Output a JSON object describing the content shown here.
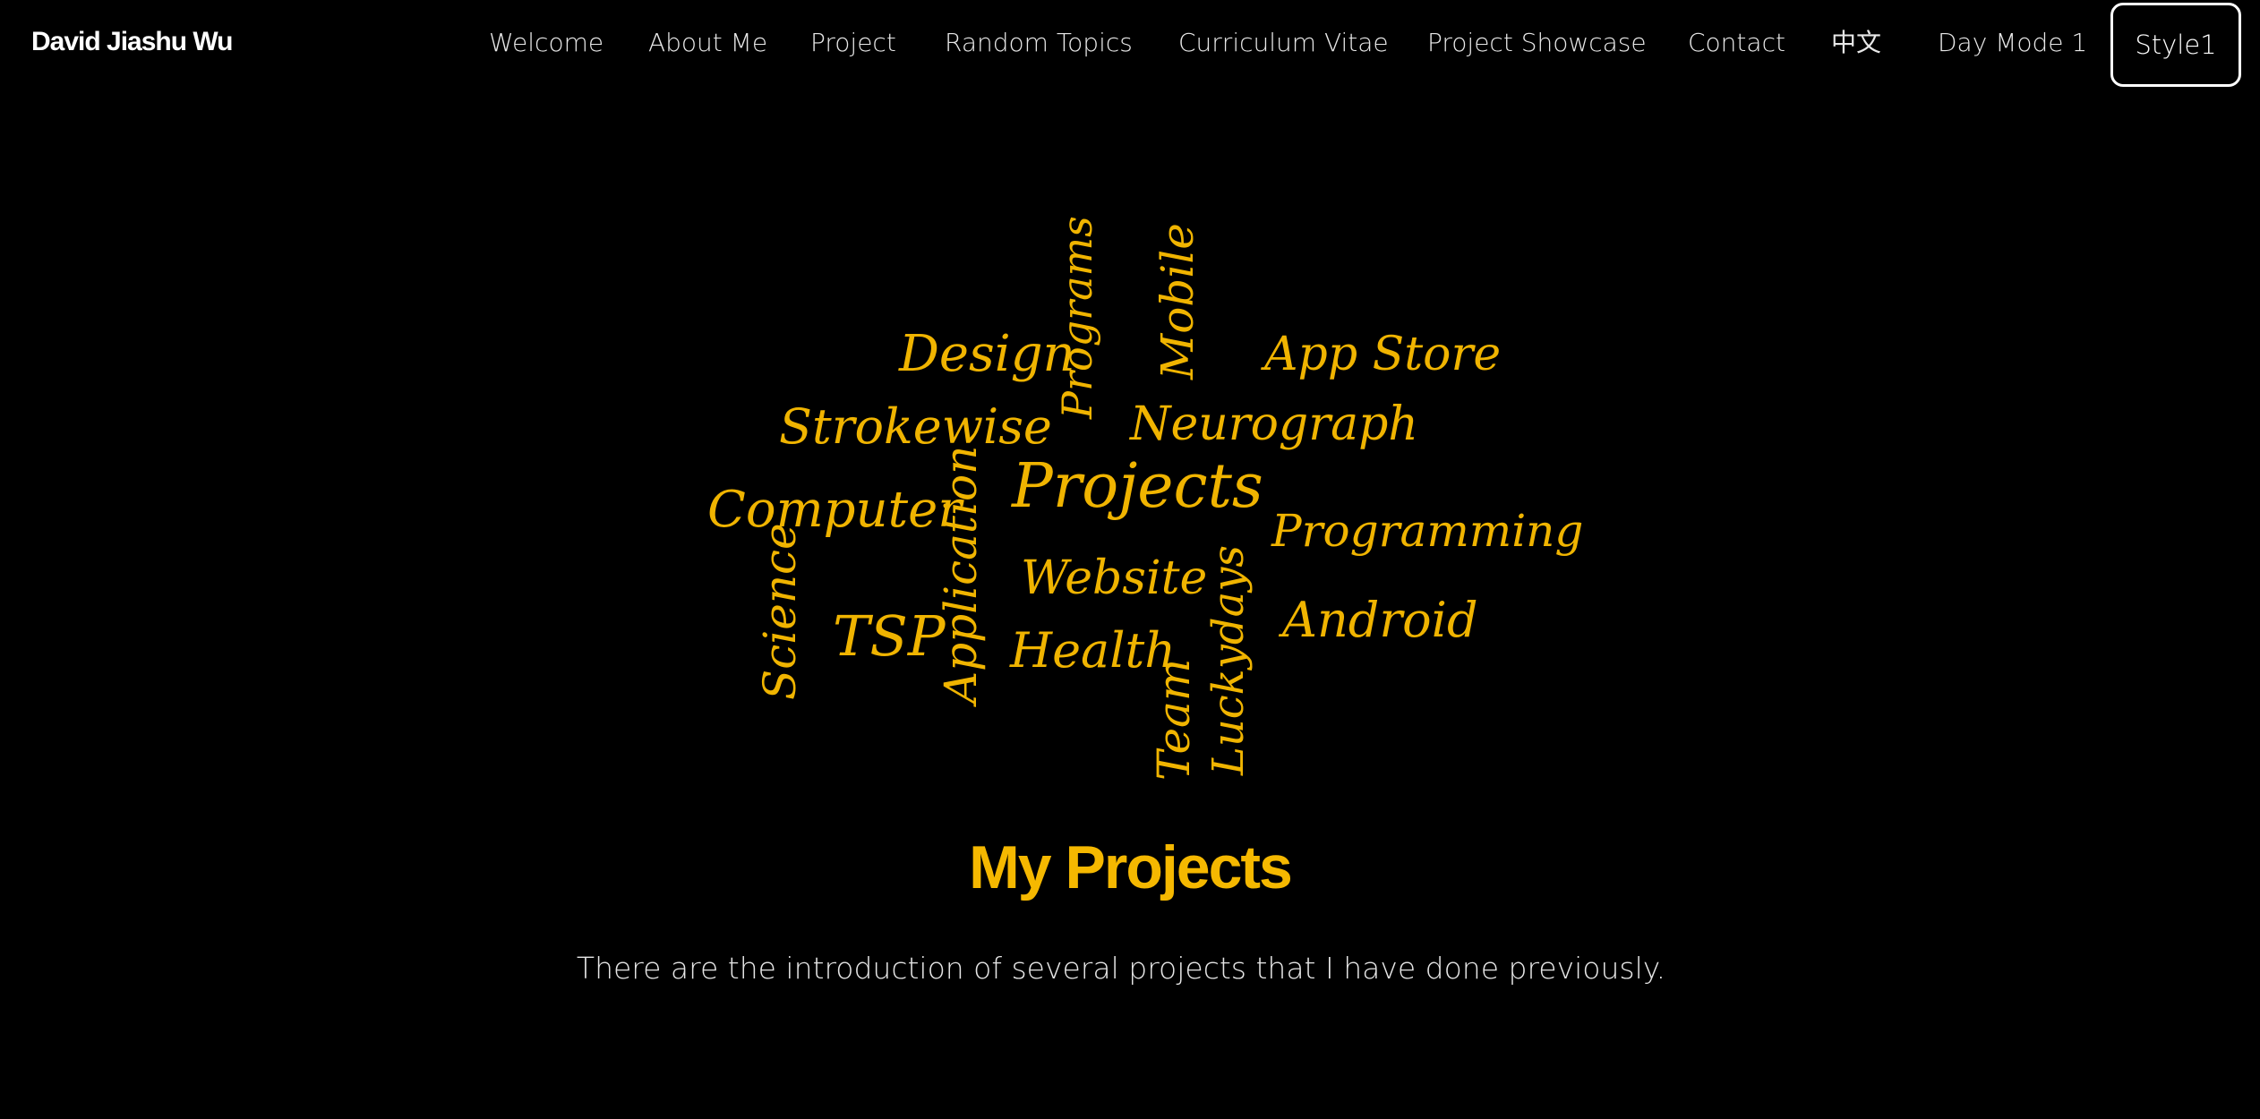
{
  "brand": "David Jiashu Wu",
  "nav": {
    "items": [
      "Welcome",
      "About Me",
      "Project",
      "Random Topics",
      "Curriculum Vitae",
      "Project Showcase",
      "Contact",
      "中文",
      "Day Mode 1"
    ],
    "style_button": "Style1"
  },
  "wordcloud": {
    "color": "#f0b400",
    "words": [
      "Design",
      "Programs",
      "Mobile",
      "App Store",
      "Strokewise",
      "Neurograph",
      "Computer",
      "Application",
      "Projects",
      "Programming",
      "Science",
      "Website",
      "TSP",
      "Health",
      "Luckydays",
      "Android",
      "Team"
    ]
  },
  "main": {
    "title": "My Projects",
    "subtitle": "There are the introduction of several projects that I have done previously."
  },
  "colors": {
    "background": "#000000",
    "accent": "#f5b800",
    "text": "#e6e6e6"
  }
}
